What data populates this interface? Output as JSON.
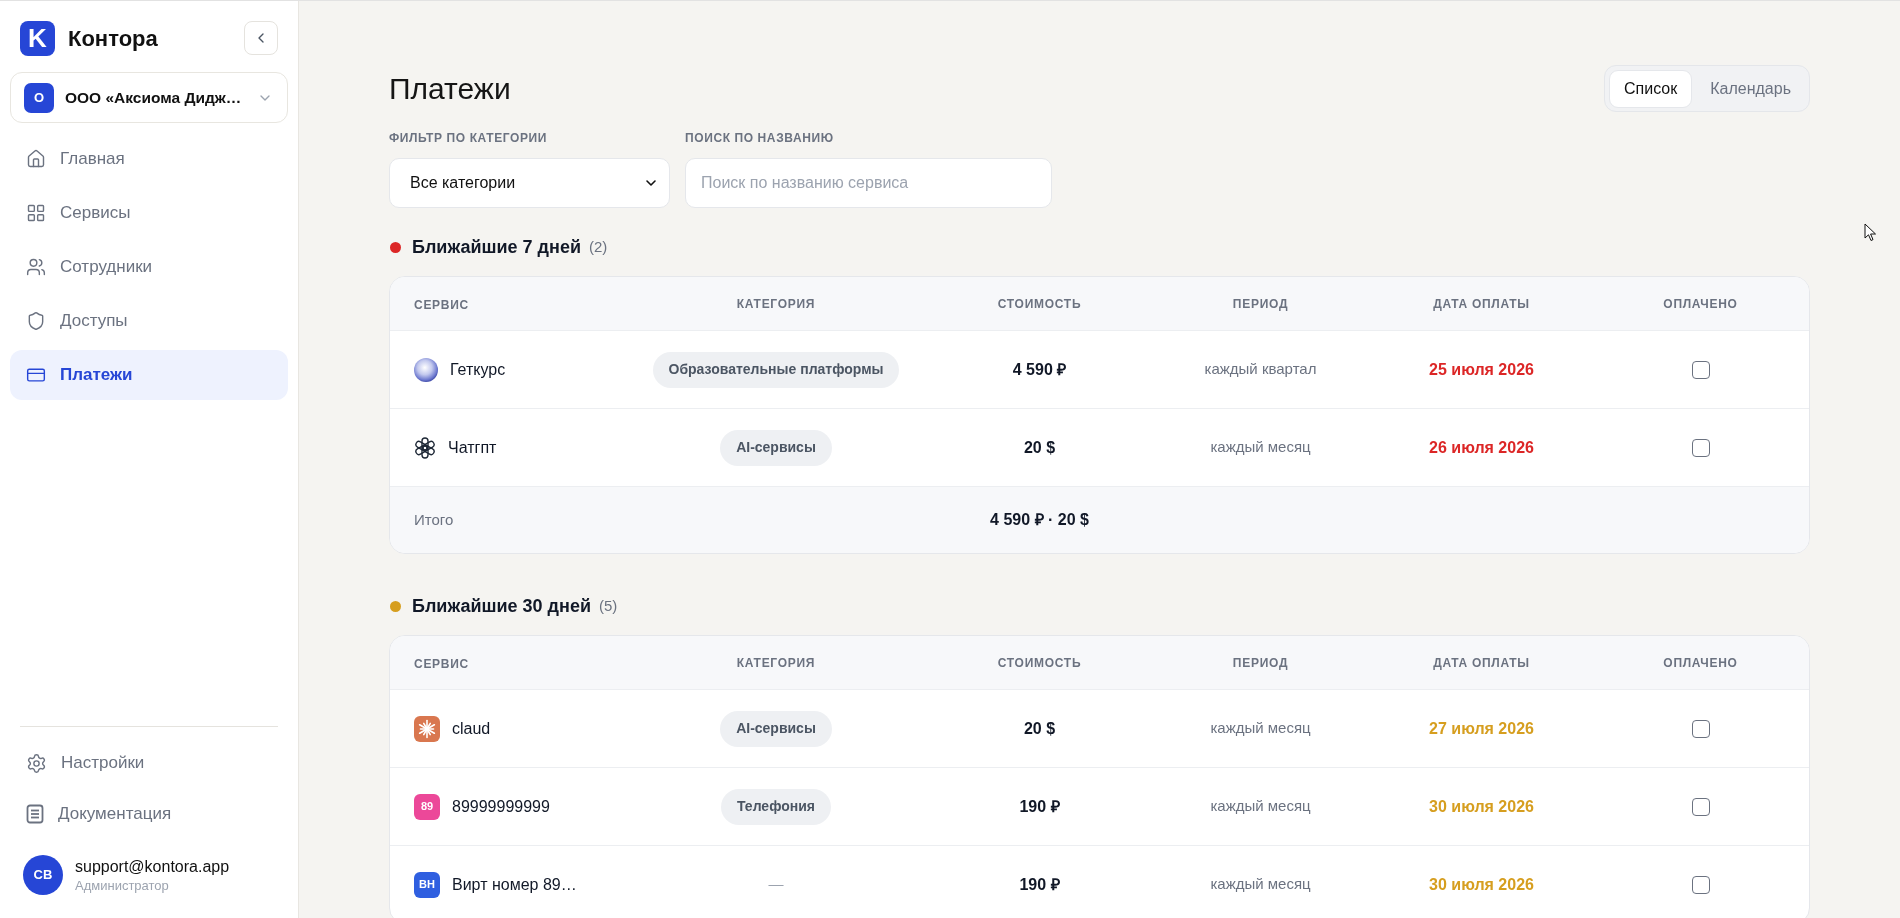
{
  "sidebar": {
    "logo": {
      "letter": "K",
      "text": "Контора"
    },
    "organization": {
      "initial": "О",
      "name": "ООО «Аксиома Дидж…"
    },
    "nav_items": [
      {
        "label": "Главная",
        "selected": false
      },
      {
        "label": "Сервисы",
        "selected": false
      },
      {
        "label": "Сотрудники",
        "selected": false
      },
      {
        "label": "Доступы",
        "selected": false
      },
      {
        "label": "Платежи",
        "selected": true
      }
    ],
    "footer_items": [
      {
        "label": "Настройки"
      },
      {
        "label": "Документация"
      }
    ],
    "user": {
      "initials": "СВ",
      "email": "support@kontora.app",
      "role": "Администратор"
    }
  },
  "page": {
    "title": "Платежи",
    "view_tabs": [
      {
        "label": "Список",
        "selected": true
      },
      {
        "label": "Календарь",
        "selected": false
      }
    ],
    "filters": {
      "category": {
        "label": "ФИЛЬТР ПО КАТЕГОРИИ",
        "value": "Все категории"
      },
      "search": {
        "label": "ПОИСК ПО НАЗВАНИЮ",
        "placeholder": "Поиск по названию сервиса"
      }
    }
  },
  "sections": [
    {
      "title": "Ближайшие 7 дней",
      "count": "(2)",
      "color": "#dc2626",
      "columns": [
        "СЕРВИС",
        "КАТЕГОРИЯ",
        "СТОИМОСТЬ",
        "ПЕРИОД",
        "ДАТА ОПЛАТЫ",
        "ОПЛАЧЕНО"
      ],
      "rows": [
        {
          "service": "Геткурс",
          "logo": {
            "kind": "globe"
          },
          "category": {
            "kind": "tag",
            "text": "Образовательные платформы"
          },
          "cost": "4 590 ₽",
          "period": "каждый квартал",
          "due_date": "25 июля 2026",
          "paid": false
        },
        {
          "service": "Чатгпт",
          "logo": {
            "kind": "knot"
          },
          "category": {
            "kind": "tag",
            "text": "AI-сервисы"
          },
          "cost": "20 $",
          "period": "каждый месяц",
          "due_date": "26 июля 2026",
          "paid": false
        }
      ],
      "total": {
        "label": "Итого",
        "value": "4 590 ₽ · 20 $"
      }
    },
    {
      "title": "Ближайшие 30 дней",
      "count": "(5)",
      "color": "#d69e1f",
      "columns": [
        "СЕРВИС",
        "КАТЕГОРИЯ",
        "СТОИМОСТЬ",
        "ПЕРИОД",
        "ДАТА ОПЛАТЫ",
        "ОПЛАЧЕНО"
      ],
      "rows": [
        {
          "service": "claud",
          "logo": {
            "kind": "starburst"
          },
          "category": {
            "kind": "tag",
            "text": "AI-сервисы"
          },
          "cost": "20 $",
          "period": "каждый месяц",
          "due_date": "27 июля 2026",
          "paid": false
        },
        {
          "service": "89999999999",
          "logo": {
            "kind": "initials",
            "text": "89",
            "color": "#ec4899"
          },
          "category": {
            "kind": "tag",
            "text": "Телефония"
          },
          "cost": "190 ₽",
          "period": "каждый месяц",
          "due_date": "30 июля 2026",
          "paid": false
        },
        {
          "service": "Вирт номер 89…",
          "logo": {
            "kind": "initials",
            "text": "ВН",
            "color": "#2f5fe0"
          },
          "category": {
            "kind": "dash",
            "text": "—"
          },
          "cost": "190 ₽",
          "period": "каждый месяц",
          "due_date": "30 июля 2026",
          "paid": false
        }
      ]
    }
  ]
}
